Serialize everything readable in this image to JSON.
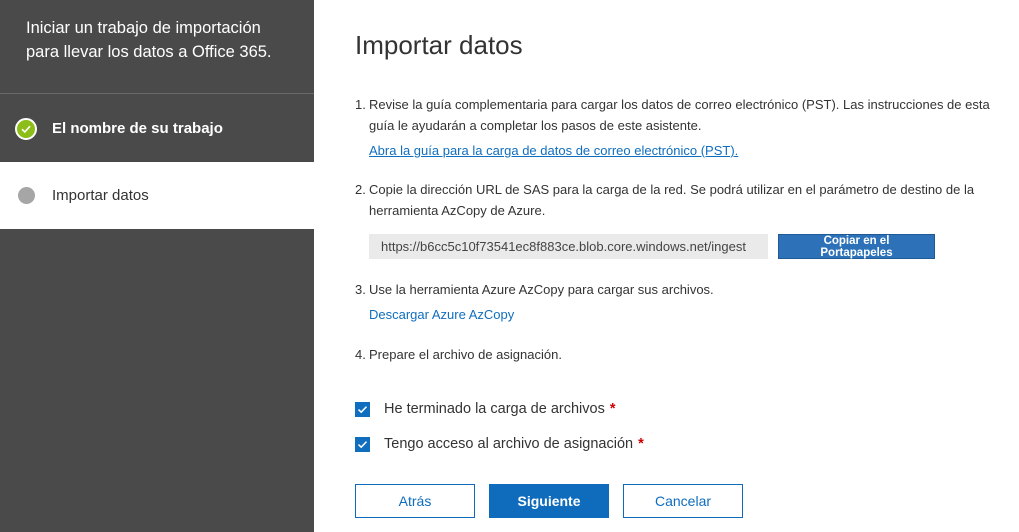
{
  "sidebar": {
    "header_line1": "Iniciar un trabajo de importación",
    "header_line2": "para llevar los datos a Office 365.",
    "steps": [
      {
        "label": "El nombre de su trabajo",
        "status": "done",
        "icon": "check-circle-icon"
      },
      {
        "label": "Importar datos",
        "status": "current",
        "icon": "circle-icon"
      }
    ]
  },
  "main": {
    "title": "Importar datos",
    "items": [
      {
        "num": "1.",
        "text": "Revise la guía complementaria para cargar los datos de correo electrónico (PST). Las instrucciones de esta guía le ayudarán a completar los pasos de este asistente.",
        "link": "Abra la guía para la carga de datos de correo electrónico (PST)."
      },
      {
        "num": "2.",
        "text": "Copie la dirección URL de SAS para la carga de la red. Se podrá utilizar en el parámetro de destino de la herramienta AzCopy de Azure."
      },
      {
        "num": "3.",
        "text": "Use la herramienta Azure AzCopy para cargar sus archivos.",
        "link": "Descargar Azure AzCopy"
      },
      {
        "num": "4.",
        "text": "Prepare el archivo de asignación."
      }
    ],
    "sas_url": "https://b6cc5c10f73541ec8f883ce.blob.core.windows.net/ingest",
    "copy_button": "Copiar en el Portapapeles",
    "checkboxes": [
      {
        "label": "He terminado la carga de archivos",
        "checked": true,
        "required": "*"
      },
      {
        "label": "Tengo acceso al archivo de asignación",
        "checked": true,
        "required": "*"
      }
    ],
    "buttons": {
      "back": "Atrás",
      "next": "Siguiente",
      "cancel": "Cancelar"
    }
  },
  "colors": {
    "sidebar_bg": "#4a4a4a",
    "accent": "#0f6cbd",
    "done_green": "#8cbd18",
    "required_red": "#cc0000"
  }
}
